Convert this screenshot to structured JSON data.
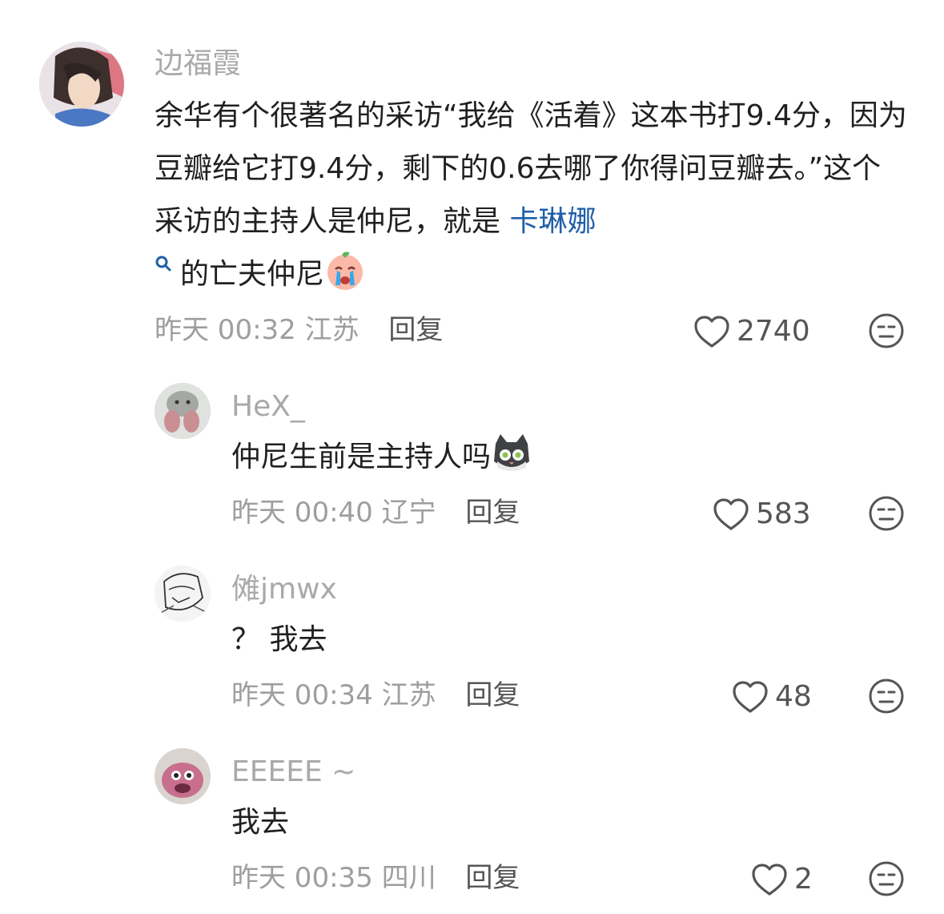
{
  "comments": [
    {
      "username": "边福霞",
      "content_prefix": "余华有个很著名的采访“我给《活着》这本书打9.4分，因为豆瓣给它打9.4分，剩下的0.6去哪了你得问豆瓣去。”这个采访的主持人是仲尼，就是 ",
      "link_text": "卡琳娜",
      "content_suffix": "的亡夫仲尼",
      "emoji": "crying-face-emoji",
      "time": "昨天 00:32",
      "location": "江苏",
      "reply_label": "回复",
      "likes": "2740"
    },
    {
      "username": "HeX_",
      "content": "仲尼生前是主持人吗",
      "emoji": "cat-face-emoji",
      "time": "昨天 00:40",
      "location": "辽宁",
      "reply_label": "回复",
      "likes": "583"
    },
    {
      "username": "傩jmwx",
      "content": "？ 我去",
      "time": "昨天 00:34",
      "location": "江苏",
      "reply_label": "回复",
      "likes": "48"
    },
    {
      "username": "EEEEE ~",
      "content": "我去",
      "time": "昨天 00:35",
      "location": "四川",
      "reply_label": "回复",
      "likes": "2"
    }
  ],
  "colors": {
    "link": "#1f5fa8",
    "muted": "#9e9e9e",
    "username": "#a9a9a9"
  },
  "icons": [
    "heart-icon",
    "unamused-face-icon",
    "search-icon"
  ]
}
